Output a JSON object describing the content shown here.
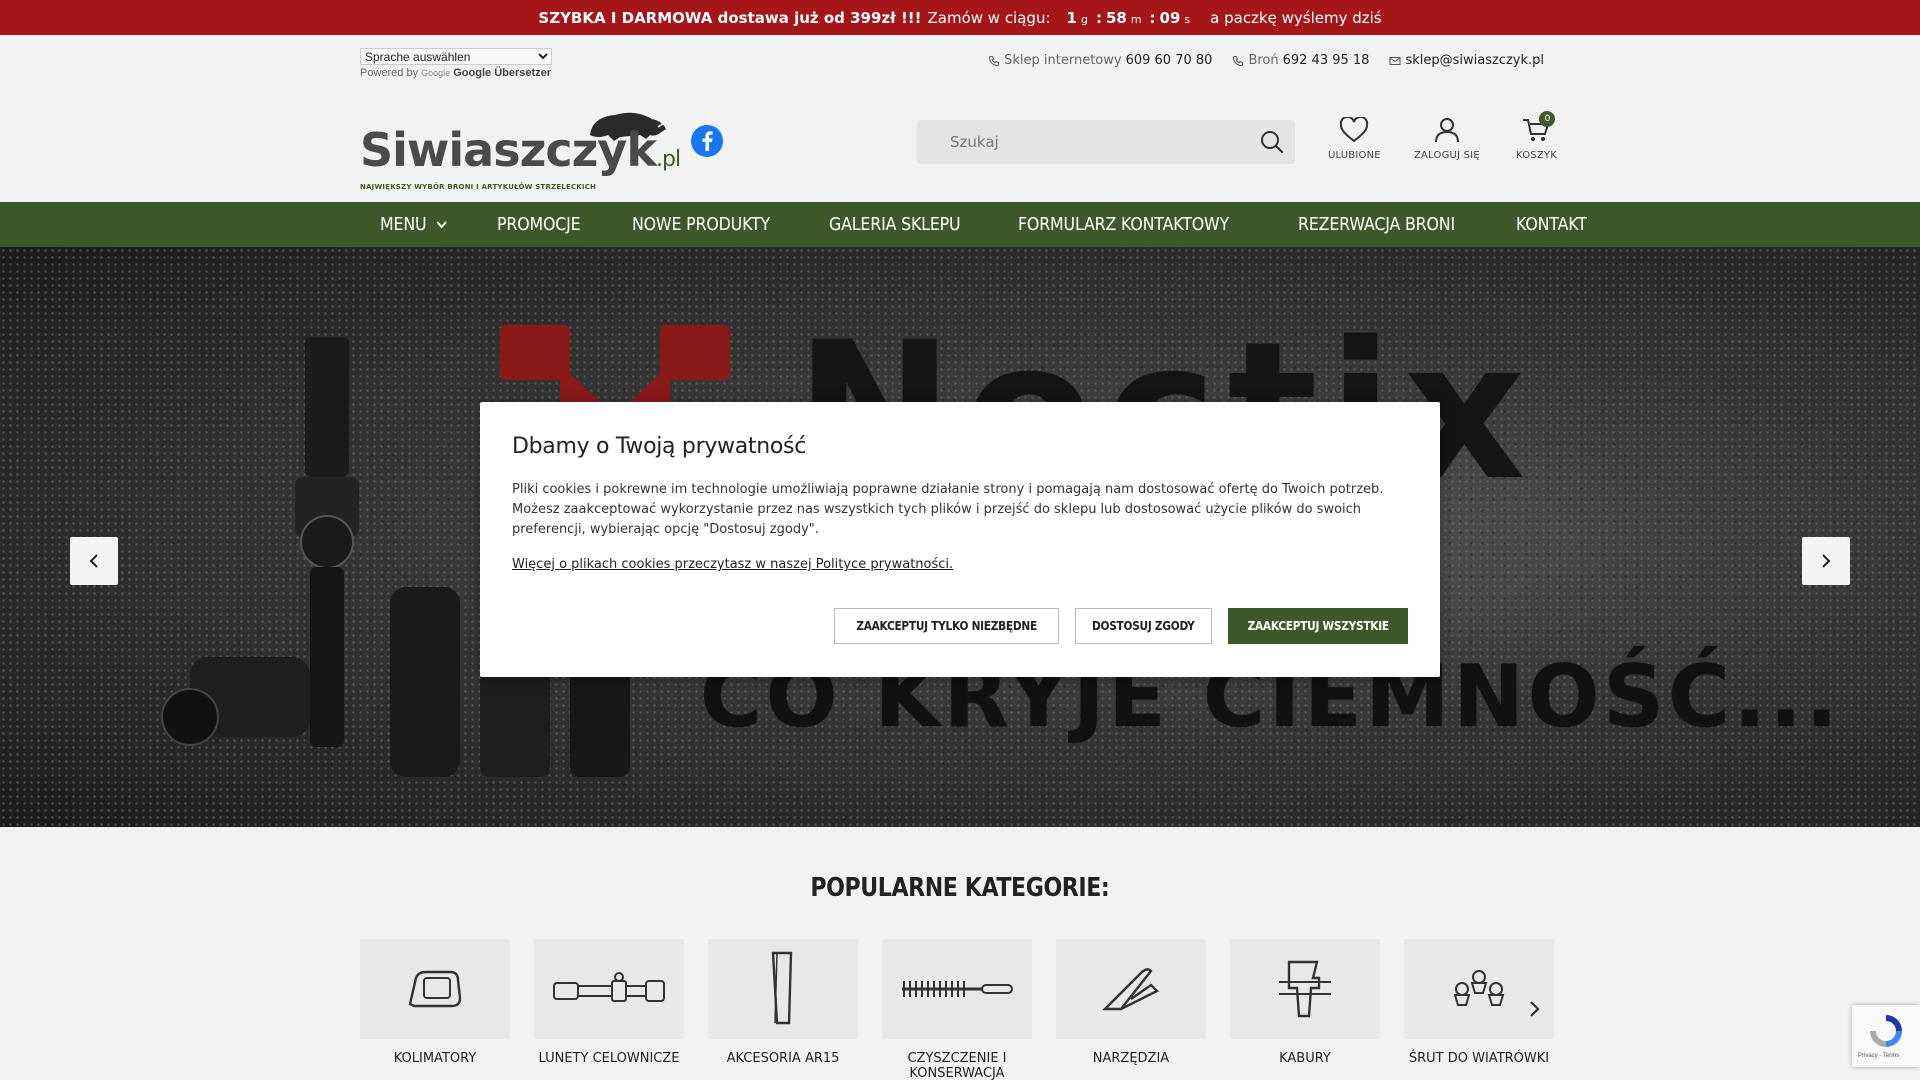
{
  "promo": {
    "headline": "SZYBKA I DARMOWA dostawa już od 399zł !!!",
    "order_within": "Zamów w ciągu:",
    "hours": "1",
    "hours_unit": "g",
    "minutes": "58",
    "minutes_unit": "m",
    "seconds": "09",
    "seconds_unit": "s",
    "tail": "a paczkę wyślemy dziś",
    "bg_color": "#a51619"
  },
  "translate": {
    "select_label": "Sprache auswählen",
    "powered_by": "Powered by",
    "google_word": "Google",
    "translator": "Google Übersetzer"
  },
  "contacts": {
    "shop_label": "Sklep internetowy",
    "shop_phone": "609 60 70 80",
    "guns_label": "Broń",
    "guns_phone": "692 43 95 18",
    "email": "sklep@siwiaszczyk.pl"
  },
  "logo": {
    "name": "Siwiaszczyk",
    "tld": ".pl",
    "tagline": "NAJWIĘKSZY WYBÓR BRONI I ARTYKUŁÓW STRZELECKICH"
  },
  "search": {
    "placeholder": "Szukaj"
  },
  "header_actions": {
    "favorites": "ULUBIONE",
    "login": "ZALOGUJ SIĘ",
    "cart": "KOSZYK",
    "cart_count": "0"
  },
  "nav": {
    "items": [
      "MENU",
      "PROMOCJE",
      "NOWE PRODUKTY",
      "GALERIA SKLEPU",
      "FORMULARZ KONTAKTOWY",
      "REZERWACJA BRONI",
      "KONTAKT"
    ]
  },
  "hero": {
    "brand": "Noctix",
    "slogan": "CO KRYJE CIEMNOŚĆ..."
  },
  "categories": {
    "title": "POPULARNE KATEGORIE:",
    "items": [
      {
        "name": "KOLIMATORY",
        "icon": "red-dot-sight-icon"
      },
      {
        "name": "LUNETY CELOWNICZE",
        "icon": "rifle-scope-icon"
      },
      {
        "name": "AKCESORIA AR15",
        "icon": "magazine-icon"
      },
      {
        "name": "CZYSZCZENIE I KONSERWACJA",
        "icon": "cleaning-brush-icon"
      },
      {
        "name": "NARZĘDZIA",
        "icon": "multitool-icon"
      },
      {
        "name": "KABURY",
        "icon": "holster-icon"
      },
      {
        "name": "ŚRUT DO WIATRÓWKI",
        "icon": "pellets-icon"
      }
    ]
  },
  "cookie_modal": {
    "title": "Dbamy o Twoją prywatność",
    "body": "Pliki cookies i pokrewne im technologie umożliwiają poprawne działanie strony i pomagają nam dostosować ofertę do Twoich potrzeb. Możesz zaakceptować wykorzystanie przez nas wszystkich tych plików i przejść do sklepu lub dostosować użycie plików do swoich preferencji, wybierając opcję \"Dostosuj zgody\".",
    "more_link": "Więcej o plikach cookies przeczytasz w naszej Polityce prywatności.",
    "btn_necessary": "ZAAKCEPTUJ TYLKO NIEZBĘDNE",
    "btn_customize": "DOSTOSUJ ZGODY",
    "btn_accept_all": "ZAAKCEPTUJ WSZYSTKIE"
  },
  "recaptcha": {
    "links": "Privacy - Terms"
  },
  "colors": {
    "accent_green": "#3d5929",
    "promo_red": "#a51619"
  }
}
